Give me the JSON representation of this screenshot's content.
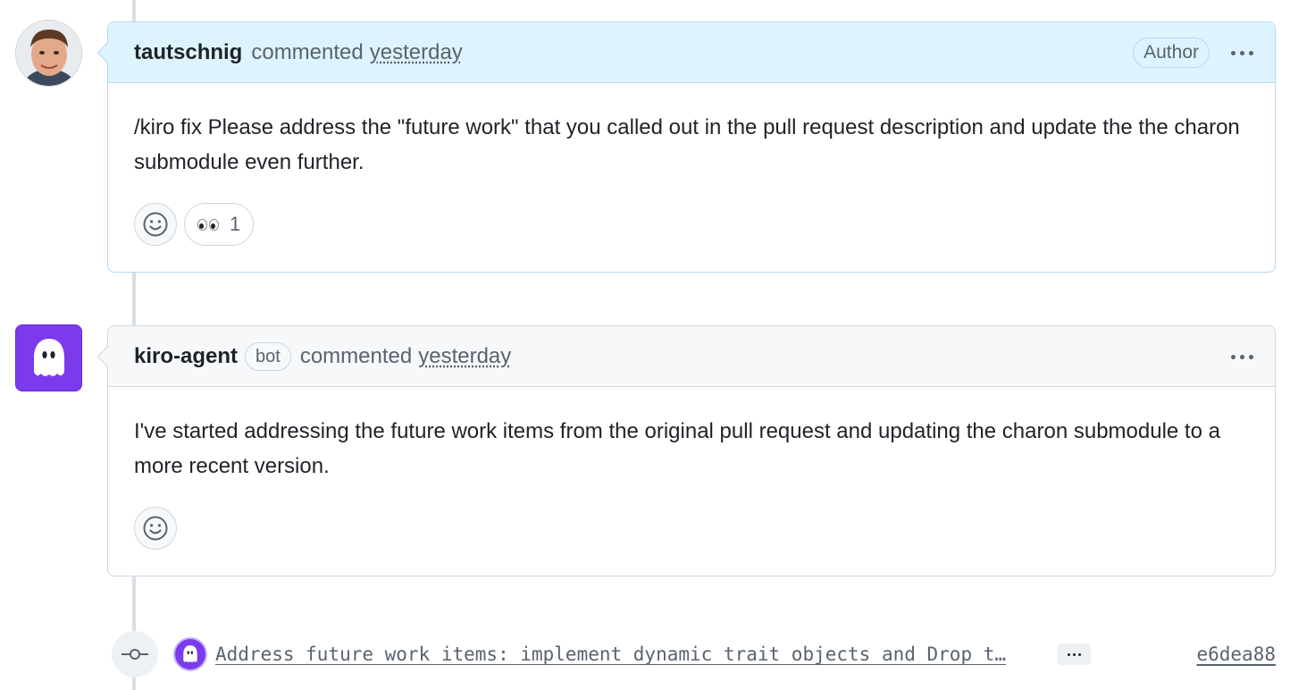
{
  "comments": [
    {
      "author": "tautschnig",
      "action": "commented",
      "time": "yesterday",
      "badge": "Author",
      "body": "/kiro fix Please address the \"future work\" that you called out in the pull request description and update the the charon submodule even further.",
      "reactions": [
        {
          "icon": "eyes-emoji",
          "count": "1"
        }
      ]
    },
    {
      "author": "kiro-agent",
      "bot_label": "bot",
      "action": "commented",
      "time": "yesterday",
      "body": "I've started addressing the future work items from the original pull request and updating the charon submodule to a more recent version."
    }
  ],
  "commit": {
    "message": "Address future work items: implement dynamic trait objects and Drop t…",
    "sha": "e6dea88",
    "icon": "git-commit-icon"
  },
  "colors": {
    "author_header_bg": "#ddf4ff",
    "bot_avatar_bg": "#7c3aed",
    "muted_text": "#59636e",
    "border": "#d0d7de"
  }
}
